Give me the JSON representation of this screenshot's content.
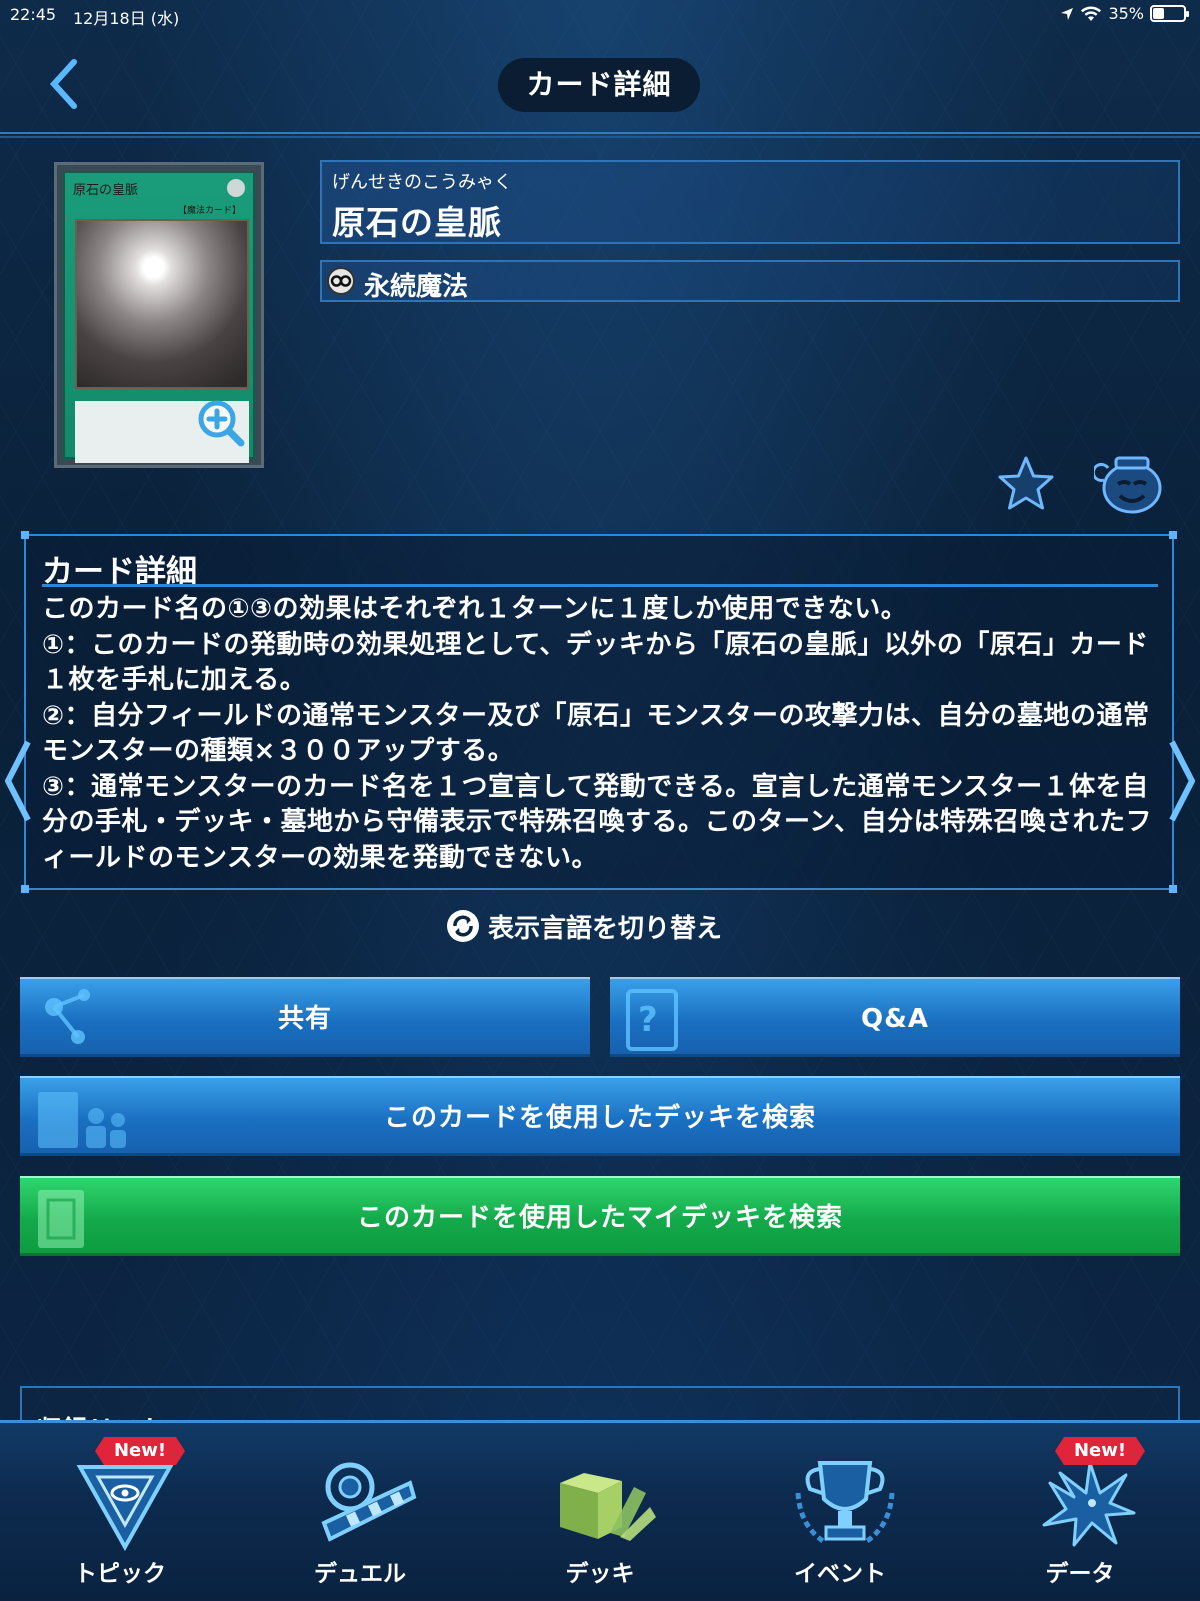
{
  "status_bar": {
    "time": "22:45",
    "date": "12月18日 (水)",
    "battery": "35%",
    "battery_level": 0.35
  },
  "header": {
    "title": "カード詳細"
  },
  "card": {
    "ruby": "げんせきのこうみゃく",
    "name": "原石の皇脈",
    "type_label": "永続魔法",
    "thumb_name": "原石の皇脈",
    "thumb_type": "【魔法カード】"
  },
  "description": {
    "title": "カード詳細",
    "text": "このカード名の①③の効果はそれぞれ１ターンに１度しか使用できない。\n①：このカードの発動時の効果処理として、デッキから「原石の皇脈」以外の「原石」カード１枚を手札に加える。\n②：自分フィールドの通常モンスター及び「原石」モンスターの攻撃力は、自分の墓地の通常モンスターの種類×３００アップする。\n③：通常モンスターのカード名を１つ宣言して発動できる。宣言した通常モンスター１体を自分の手札・デッキ・墓地から守備表示で特殊召喚する。このターン、自分は特殊召喚されたフィールドのモンスターの効果を発動できない。"
  },
  "actions": {
    "toggle_language": "表示言語を切り替え",
    "share": "共有",
    "qa": "Q&A",
    "search_decks": "このカードを使用したデッキを検索",
    "search_my_decks": "このカードを使用したマイデッキを検索"
  },
  "release_list": {
    "title": "収録リスト"
  },
  "bottom_nav": {
    "items": [
      {
        "label": "トピック",
        "badge": "New!"
      },
      {
        "label": "デュエル",
        "badge": ""
      },
      {
        "label": "デッキ",
        "badge": ""
      },
      {
        "label": "イベント",
        "badge": ""
      },
      {
        "label": "データ",
        "badge": "New!"
      }
    ]
  },
  "colors": {
    "accent_blue": "#2d74b8",
    "button_blue": "#1a6fc0",
    "button_green": "#13a94a",
    "badge_red": "#e0253a"
  }
}
